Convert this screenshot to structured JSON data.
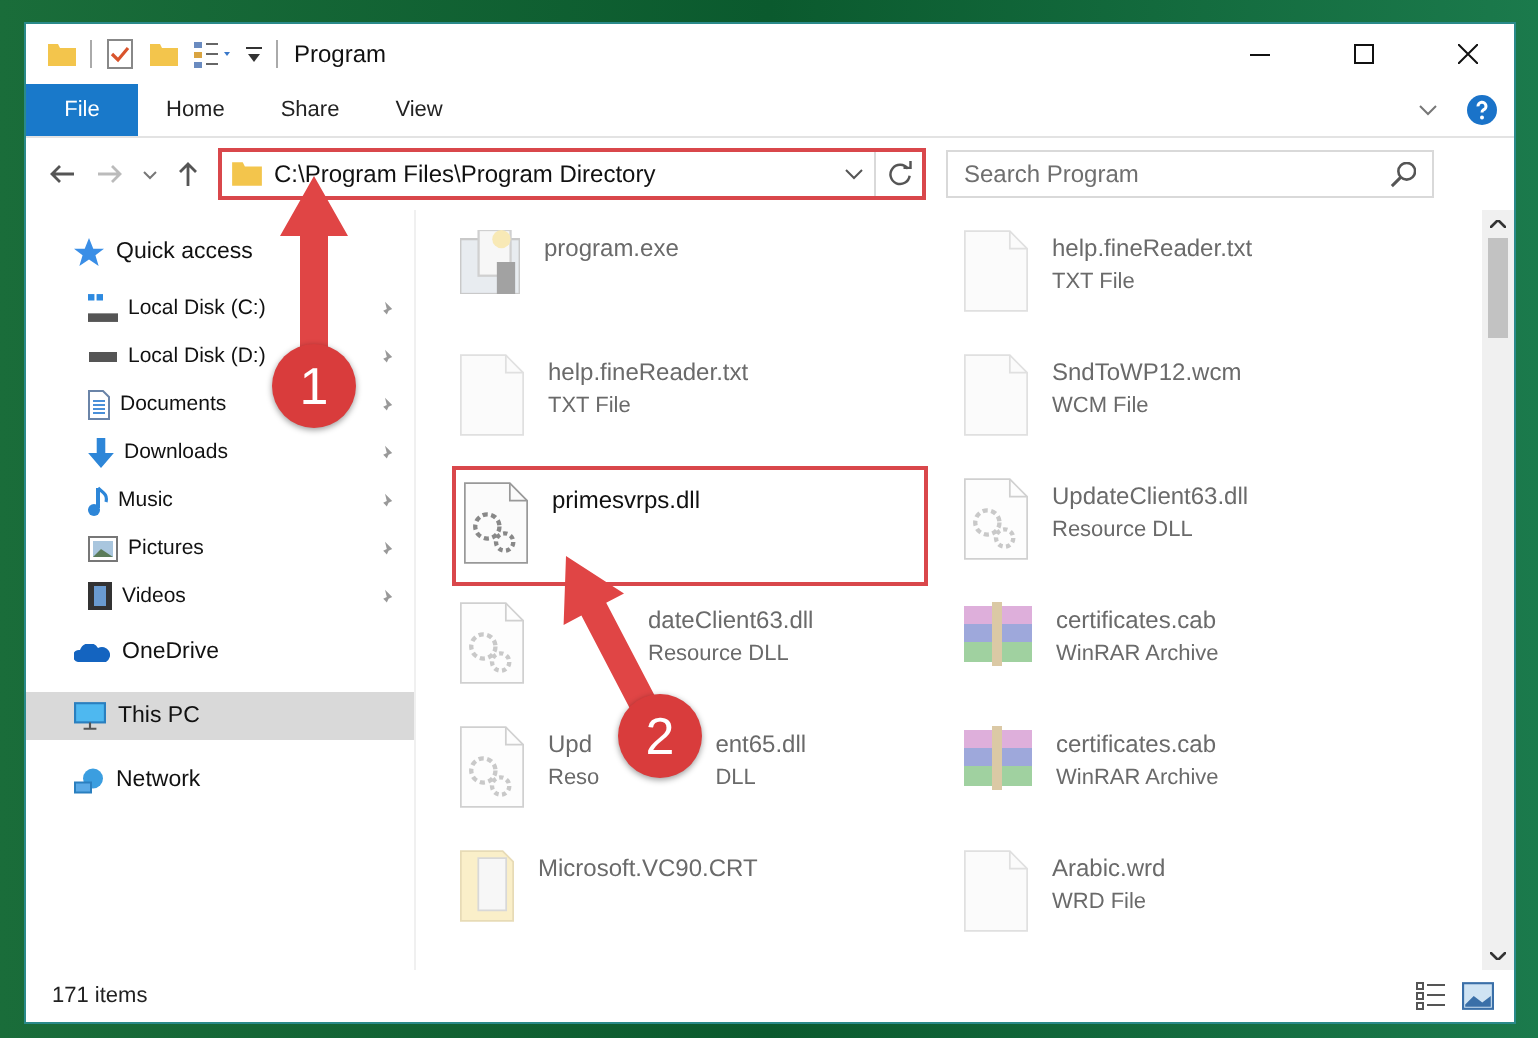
{
  "window": {
    "title": "Program"
  },
  "ribbon_tabs": [
    {
      "label": "File",
      "selected": true
    },
    {
      "label": "Home",
      "selected": false
    },
    {
      "label": "Share",
      "selected": false
    },
    {
      "label": "View",
      "selected": false
    }
  ],
  "address_bar": {
    "path": "C:\\Program Files\\Program Directory",
    "highlighted": true
  },
  "search": {
    "placeholder": "Search Program"
  },
  "sidebar": {
    "items": [
      {
        "label": "Quick access",
        "kind": "star",
        "pinned": false,
        "selected": false
      },
      {
        "label": "Local Disk (C:)",
        "kind": "sysdisk",
        "pinned": true,
        "selected": false
      },
      {
        "label": "Local Disk (D:)",
        "kind": "disk",
        "pinned": true,
        "selected": false
      },
      {
        "label": "Documents",
        "kind": "doc",
        "pinned": true,
        "selected": false
      },
      {
        "label": "Downloads",
        "kind": "download",
        "pinned": true,
        "selected": false
      },
      {
        "label": "Music",
        "kind": "music",
        "pinned": true,
        "selected": false
      },
      {
        "label": "Pictures",
        "kind": "pictures",
        "pinned": true,
        "selected": false
      },
      {
        "label": "Videos",
        "kind": "videos",
        "pinned": true,
        "selected": false
      },
      {
        "label": "OneDrive",
        "kind": "cloud",
        "pinned": false,
        "selected": false
      },
      {
        "label": "This PC",
        "kind": "pc",
        "pinned": false,
        "selected": true
      },
      {
        "label": "Network",
        "kind": "network",
        "pinned": false,
        "selected": false
      }
    ]
  },
  "files": [
    {
      "name": "program.exe",
      "kind": "exe",
      "blurred": true,
      "highlighted": false
    },
    {
      "name": "help.fineReader.txt",
      "type": "TXT File",
      "kind": "blank",
      "blurred": true,
      "highlighted": false
    },
    {
      "name": "help.fineReader.txt",
      "type": "TXT File",
      "kind": "blank",
      "blurred": true,
      "highlighted": false
    },
    {
      "name": "SndToWP12.wcm",
      "type": "WCM File",
      "kind": "blank",
      "blurred": true,
      "highlighted": false
    },
    {
      "name": "primesvrps.dll",
      "kind": "dll",
      "blurred": false,
      "highlighted": true
    },
    {
      "name": "UpdateClient63.dll",
      "type": "Resource DLL",
      "kind": "dll",
      "blurred": true,
      "highlighted": false
    },
    {
      "name": "dateClient63.dll",
      "type": "Resource DLL",
      "kind": "dll",
      "blurred": true,
      "highlighted": false
    },
    {
      "name": "certificates.cab",
      "type": "WinRAR Archive",
      "kind": "rar",
      "blurred": true,
      "highlighted": false
    },
    {
      "name": "Upd",
      "type": "Reso",
      "name_tail": "ent65.dll",
      "type_tail": "DLL",
      "kind": "dll",
      "blurred": true,
      "highlighted": false
    },
    {
      "name": "certificates.cab",
      "type": "WinRAR Archive",
      "kind": "rar",
      "blurred": true,
      "highlighted": false
    },
    {
      "name": "Microsoft.VC90.CRT",
      "kind": "folder",
      "blurred": true,
      "highlighted": false
    },
    {
      "name": "Arabic.wrd",
      "type": "WRD File",
      "kind": "blank",
      "blurred": true,
      "highlighted": false
    }
  ],
  "status_bar": {
    "item_count": "171 items"
  },
  "annotations": [
    {
      "number": "1"
    },
    {
      "number": "2"
    }
  ]
}
